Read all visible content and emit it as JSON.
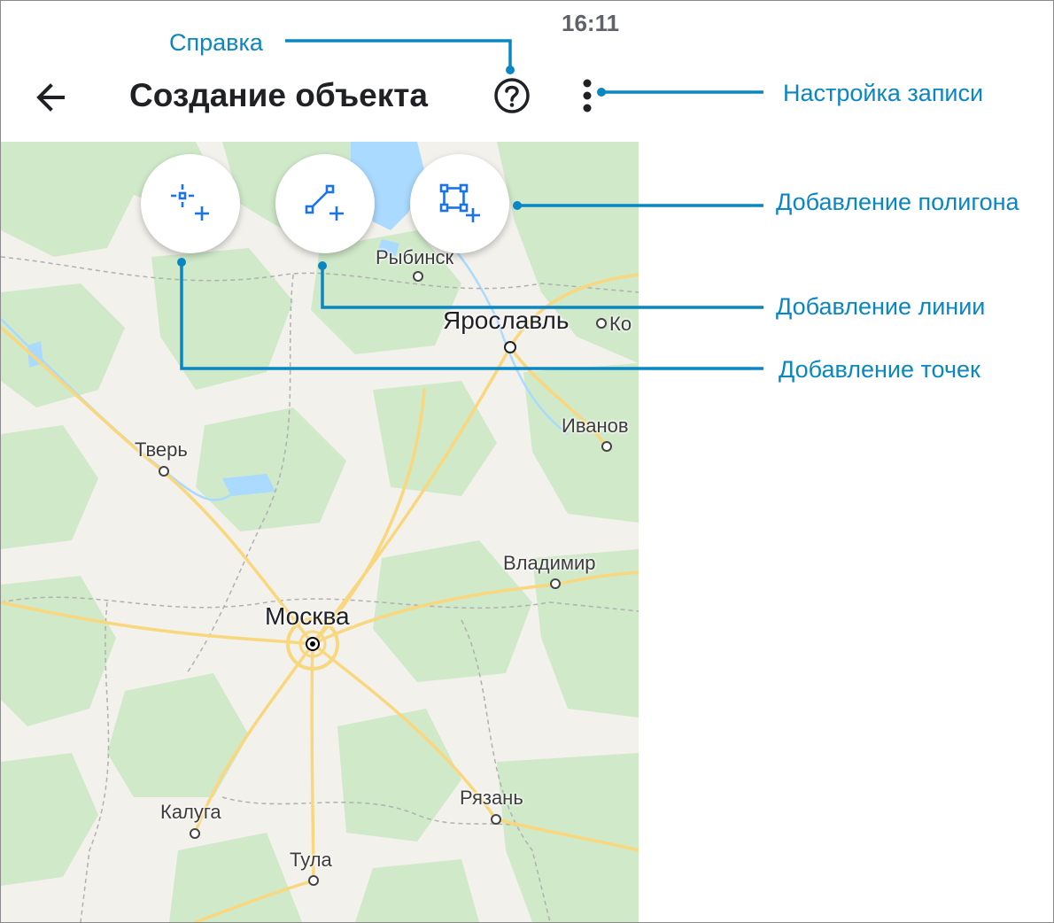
{
  "status_bar": {
    "time": "16:11"
  },
  "app_bar": {
    "title": "Создание объекта",
    "back_icon": "arrow-left-icon",
    "help_icon": "help-circle-icon",
    "menu_icon": "more-vertical-icon"
  },
  "toolbar": {
    "buttons": [
      {
        "icon": "add-point-icon"
      },
      {
        "icon": "add-line-icon"
      },
      {
        "icon": "add-polygon-icon"
      }
    ]
  },
  "map": {
    "cities": [
      {
        "name": "Рыбинск"
      },
      {
        "name": "Ярославль"
      },
      {
        "name": "Кострома",
        "visible_text": "Ко"
      },
      {
        "name": "Иваново",
        "visible_text": "Иванов"
      },
      {
        "name": "Тверь"
      },
      {
        "name": "Владимир"
      },
      {
        "name": "Москва"
      },
      {
        "name": "Рязань"
      },
      {
        "name": "Калуга"
      },
      {
        "name": "Тула"
      }
    ]
  },
  "callouts": {
    "help": "Справка",
    "record_settings": "Настройка записи",
    "add_polygon": "Добавление полигона",
    "add_line": "Добавление линии",
    "add_points": "Добавление точек"
  },
  "colors": {
    "accent": "#0a86c2",
    "tool_icon": "#1a73e8",
    "map_land": "#f3f1ec",
    "map_forest": "#cfe9c9",
    "map_water": "#aadaff",
    "map_road": "#f9d77e"
  }
}
